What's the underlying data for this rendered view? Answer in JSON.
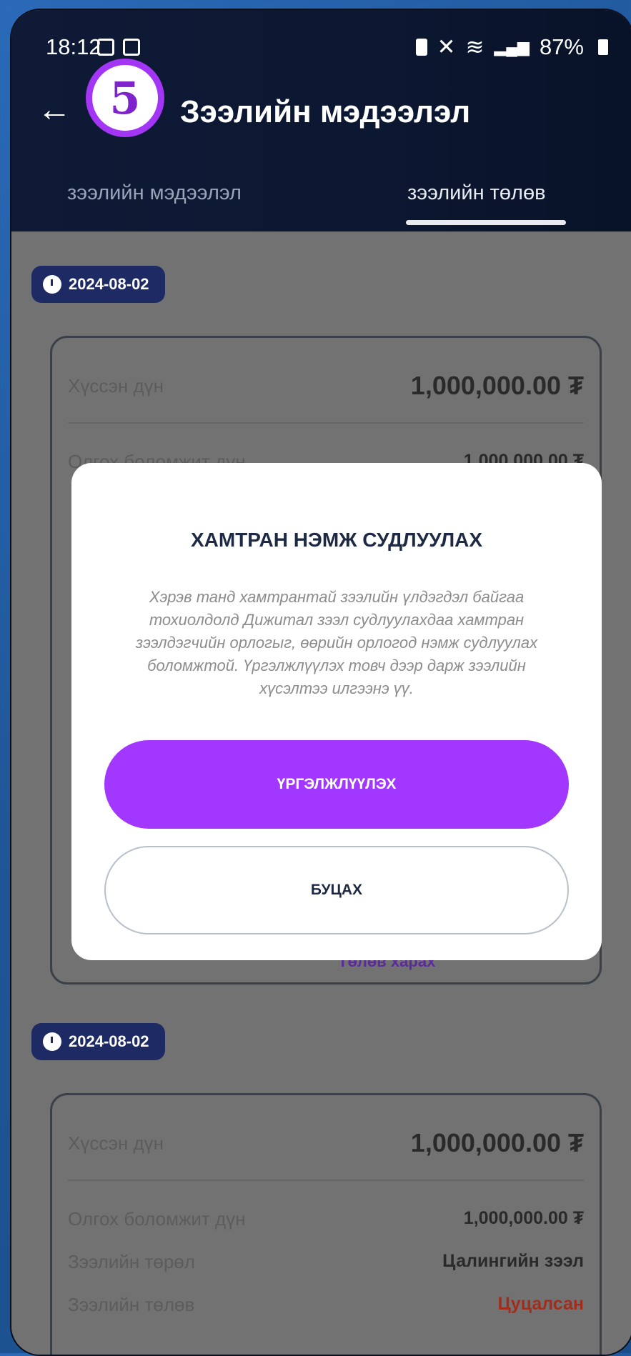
{
  "status_bar": {
    "time": "18:12",
    "battery": "87%"
  },
  "header": {
    "title": "Зээлийн мэдээлэл",
    "step_badge": "5"
  },
  "tabs": [
    {
      "label": "зээлийн мэдээлэл",
      "active": false
    },
    {
      "label": "зээлийн төлөв",
      "active": true
    }
  ],
  "entries": [
    {
      "date": "2024-08-02",
      "rows": [
        {
          "label": "Хүссэн дүн",
          "value": "1,000,000.00 ₮"
        },
        {
          "label": "Олгох боломжит дүн",
          "value": "1,000,000.00 ₮"
        }
      ],
      "link": "Төлөв харах"
    },
    {
      "date": "2024-08-02",
      "rows": [
        {
          "label": "Хүссэн дүн",
          "value": "1,000,000.00 ₮"
        },
        {
          "label": "Олгох боломжит дүн",
          "value": "1,000,000.00 ₮"
        },
        {
          "label": "Зээлийн төрөл",
          "value": "Цалингийн зээл"
        },
        {
          "label": "Зээлийн төлөв",
          "value": "Цуцалсан"
        }
      ]
    }
  ],
  "modal": {
    "title": "ХАМТРАН НЭМЖ СУДЛУУЛАХ",
    "body": "Хэрэв танд хамтрантай зээлийн үлдэгдэл байгаа тохиолдолд Дижитал зээл судлуулахдаа хамтран зээлдэгчийн орлогыг, өөрийн орлогод нэмж судлуулах боломжтой. Үргэлжлүүлэх товч дээр дарж зээлийн хүсэлтээ илгээнэ үү.",
    "primary_button": "ҮРГЭЛЖЛҮҮЛЭХ",
    "secondary_button": "БУЦАХ"
  },
  "colors": {
    "header_bg": "#0e1a36",
    "accent_purple": "#a238ff",
    "status_cancelled": "#a32d1c",
    "date_chip": "#1e2a63"
  }
}
